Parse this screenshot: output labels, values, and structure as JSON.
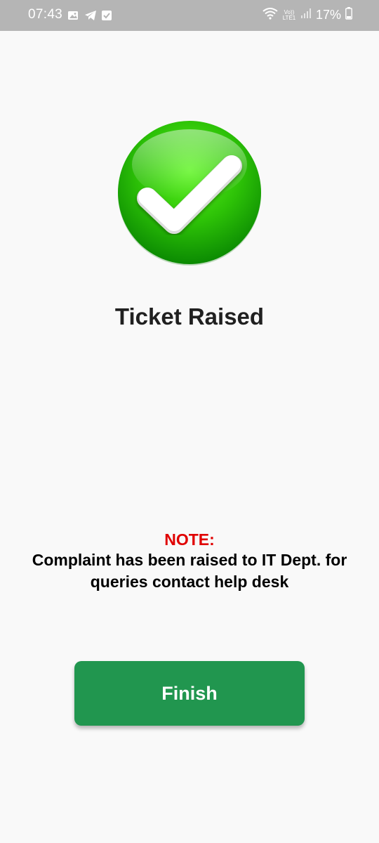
{
  "status_bar": {
    "time": "07:43",
    "network_label_top": "Vo))",
    "network_label_bottom": "LTE1",
    "battery": "17%",
    "icons": [
      "gallery-icon",
      "telegram-icon",
      "check-notification-icon",
      "wifi-icon",
      "signal-icon",
      "battery-icon"
    ]
  },
  "main": {
    "title": "Ticket Raised",
    "success_icon": "success-check-icon"
  },
  "note": {
    "label": "NOTE:",
    "text": "Complaint has been raised to IT Dept. for queries contact help desk"
  },
  "actions": {
    "finish_label": "Finish"
  },
  "colors": {
    "status_bar_bg": "#b5b5b5",
    "success_green": "#2ecc0a",
    "note_label": "#e00000",
    "button_bg": "#21964f",
    "page_bg": "#f9f9f9"
  }
}
